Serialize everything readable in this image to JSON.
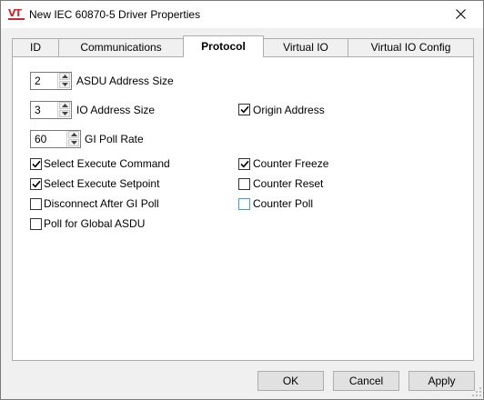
{
  "window": {
    "title": "New IEC 60870-5 Driver Properties",
    "logo_text": "VT"
  },
  "tabs": [
    {
      "label": "ID",
      "active": false
    },
    {
      "label": "Communications",
      "active": false
    },
    {
      "label": "Protocol",
      "active": true
    },
    {
      "label": "Virtual IO",
      "active": false
    },
    {
      "label": "Virtual IO Config",
      "active": false
    }
  ],
  "protocol": {
    "asdu_address_size": {
      "value": "2",
      "label": "ASDU Address Size"
    },
    "io_address_size": {
      "value": "3",
      "label": "IO Address Size"
    },
    "gi_poll_rate": {
      "value": "60",
      "label": "GI Poll Rate"
    },
    "checkboxes": {
      "origin_address": {
        "label": "Origin Address",
        "checked": true
      },
      "select_execute_command": {
        "label": "Select Execute Command",
        "checked": true
      },
      "select_execute_setpoint": {
        "label": "Select Execute Setpoint",
        "checked": true
      },
      "disconnect_after_gi_poll": {
        "label": "Disconnect After GI Poll",
        "checked": false
      },
      "poll_for_global_asdu": {
        "label": "Poll for Global ASDU",
        "checked": false
      },
      "counter_freeze": {
        "label": "Counter Freeze",
        "checked": true
      },
      "counter_reset": {
        "label": "Counter Reset",
        "checked": false
      },
      "counter_poll": {
        "label": "Counter Poll",
        "checked": false
      }
    }
  },
  "buttons": {
    "ok": "OK",
    "cancel": "Cancel",
    "apply": "Apply"
  },
  "colors": {
    "accent_hover": "#3c9ce6",
    "logo": "#d0262d"
  }
}
